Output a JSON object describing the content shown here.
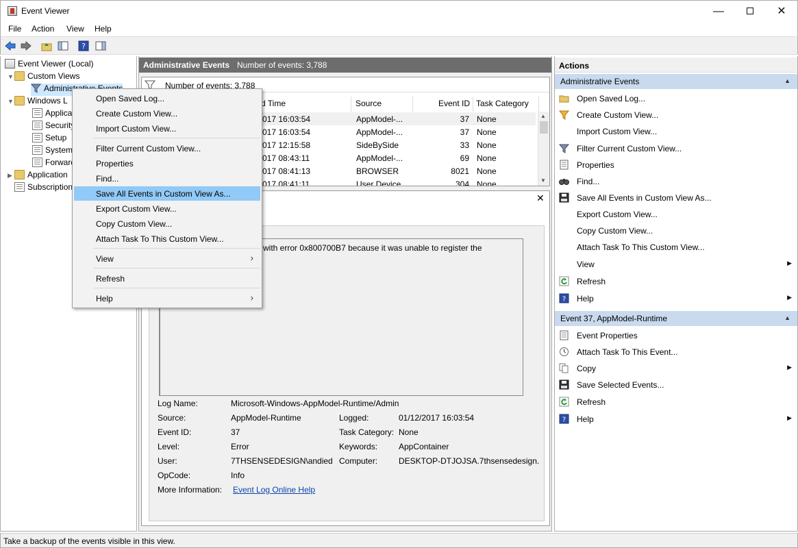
{
  "window": {
    "title": "Event Viewer"
  },
  "menubar": [
    "File",
    "Action",
    "View",
    "Help"
  ],
  "tree": {
    "root": "Event Viewer (Local)",
    "custom_views": "Custom Views",
    "admin_events": "Administrative Events",
    "windows_logs": "Windows L",
    "application": "Applica",
    "security": "Security",
    "setup": "Setup",
    "system": "System",
    "forwarded": "Forward",
    "apps_services": "Application",
    "subscriptions": "Subscription"
  },
  "center": {
    "header_title": "Administrative Events",
    "header_count": "Number of events: 3,788",
    "filter_text": "Number of events: 3,788",
    "columns": [
      "d Time",
      "Source",
      "Event ID",
      "Task Category"
    ],
    "rows": [
      {
        "time": "017 16:03:54",
        "source": "AppModel-...",
        "id": "37",
        "task": "None"
      },
      {
        "time": "017 16:03:54",
        "source": "AppModel-...",
        "id": "37",
        "task": "None"
      },
      {
        "time": "017 12:15:58",
        "source": "SideBySide",
        "id": "33",
        "task": "None"
      },
      {
        "time": "017 08:43:11",
        "source": "AppModel-...",
        "id": "69",
        "task": "None"
      },
      {
        "time": "017 08:41:13",
        "source": "BROWSER",
        "id": "8021",
        "task": "None"
      },
      {
        "time": "017 08:41:11",
        "source": "User Device",
        "id": "304",
        "task": "None"
      }
    ],
    "message": "with error 0x800700B7 because it was unable to register the",
    "details": {
      "log_name_label": "Log Name:",
      "log_name": "Microsoft-Windows-AppModel-Runtime/Admin",
      "source_label": "Source:",
      "source": "AppModel-Runtime",
      "logged_label": "Logged:",
      "logged": "01/12/2017 16:03:54",
      "event_id_label": "Event ID:",
      "event_id": "37",
      "task_label": "Task Category:",
      "task": "None",
      "level_label": "Level:",
      "level": "Error",
      "keywords_label": "Keywords:",
      "keywords": "AppContainer",
      "user_label": "User:",
      "user": "7THSENSEDESIGN\\andied",
      "computer_label": "Computer:",
      "computer": "DESKTOP-DTJOJSA.7thsensedesign.",
      "opcode_label": "OpCode:",
      "opcode": "Info",
      "more_label": "More Information:",
      "more_link": "Event Log Online Help"
    }
  },
  "actions": {
    "title": "Actions",
    "section1": "Administrative Events",
    "items1": [
      {
        "label": "Open Saved Log...",
        "icon": "folder-open-icon"
      },
      {
        "label": "Create Custom View...",
        "icon": "filter-star-icon"
      },
      {
        "label": "Import Custom View...",
        "icon": ""
      },
      {
        "label": "Filter Current Custom View...",
        "icon": "filter-icon"
      },
      {
        "label": "Properties",
        "icon": "properties-icon"
      },
      {
        "label": "Find...",
        "icon": "binoculars-icon"
      },
      {
        "label": "Save All Events in Custom View As...",
        "icon": "save-icon"
      },
      {
        "label": "Export Custom View...",
        "icon": ""
      },
      {
        "label": "Copy Custom View...",
        "icon": ""
      },
      {
        "label": "Attach Task To This Custom View...",
        "icon": ""
      },
      {
        "label": "View",
        "icon": "",
        "submenu": true
      },
      {
        "label": "Refresh",
        "icon": "refresh-icon"
      },
      {
        "label": "Help",
        "icon": "help-icon",
        "submenu": true
      }
    ],
    "section2": "Event 37, AppModel-Runtime",
    "items2": [
      {
        "label": "Event Properties",
        "icon": "properties-icon"
      },
      {
        "label": "Attach Task To This Event...",
        "icon": "task-icon"
      },
      {
        "label": "Copy",
        "icon": "copy-icon",
        "submenu": true
      },
      {
        "label": "Save Selected Events...",
        "icon": "save-icon"
      },
      {
        "label": "Refresh",
        "icon": "refresh-icon"
      },
      {
        "label": "Help",
        "icon": "help-icon",
        "submenu": true
      }
    ]
  },
  "context_menu": {
    "items": [
      "Open Saved Log...",
      "Create Custom View...",
      "Import Custom View...",
      "Filter Current Custom View...",
      "Properties",
      "Find...",
      "Save All Events in Custom View As...",
      "Export Custom View...",
      "Copy Custom View...",
      "Attach Task To This Custom View...",
      "View",
      "Refresh",
      "Help"
    ]
  },
  "status": "Take a backup of the events visible in this view.",
  "colors": {
    "selection": "#91c9f7",
    "section_header": "#c9daee",
    "header_bar": "#6d6d6d"
  }
}
